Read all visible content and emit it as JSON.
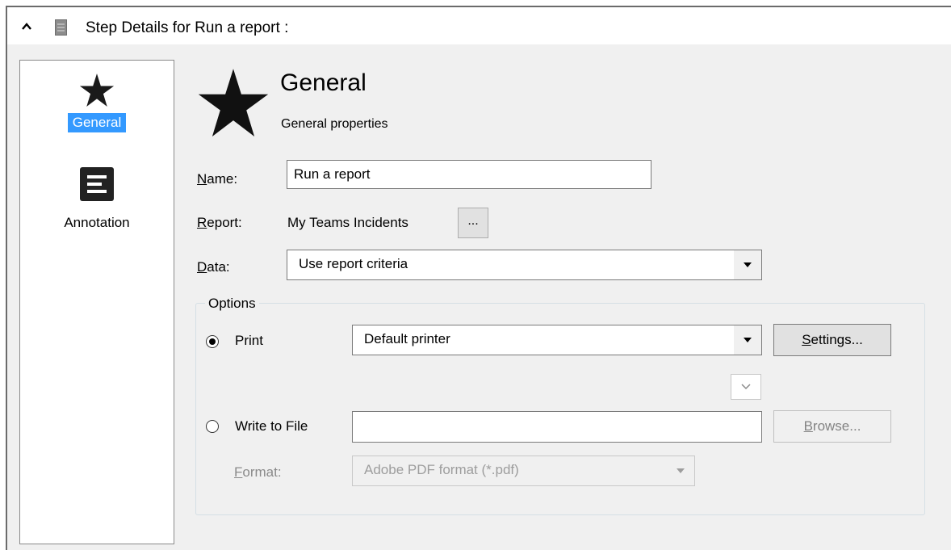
{
  "header": {
    "title": "Step Details for Run a report :"
  },
  "sidebar": {
    "items": [
      {
        "label": "General",
        "icon": "star-icon",
        "selected": true
      },
      {
        "label": "Annotation",
        "icon": "annotation-icon",
        "selected": false
      }
    ]
  },
  "main": {
    "title": "General",
    "subtitle": "General properties",
    "name": {
      "label_mnemonic": "N",
      "label_rest": "ame:",
      "value": "Run a report"
    },
    "report": {
      "label_mnemonic": "R",
      "label_rest": "eport:",
      "value": "My Teams Incidents",
      "browse_label": "..."
    },
    "data": {
      "label_mnemonic": "D",
      "label_rest": "ata:",
      "selected": "Use report criteria"
    },
    "options": {
      "legend": "Options",
      "print": {
        "label": "Print",
        "checked": true,
        "printer": "Default printer",
        "settings_mnemonic": "S",
        "settings_rest": "ettings..."
      },
      "write_to_file": {
        "label": "Write to File",
        "checked": false,
        "path": "",
        "browse_mnemonic": "B",
        "browse_rest": "rowse..."
      },
      "format": {
        "label_mnemonic": "F",
        "label_rest": "ormat:",
        "selected": "Adobe PDF format (*.pdf)"
      }
    }
  },
  "colors": {
    "selection": "#3399ff",
    "panel": "#f0f0f0",
    "border": "#8a8a8a"
  }
}
